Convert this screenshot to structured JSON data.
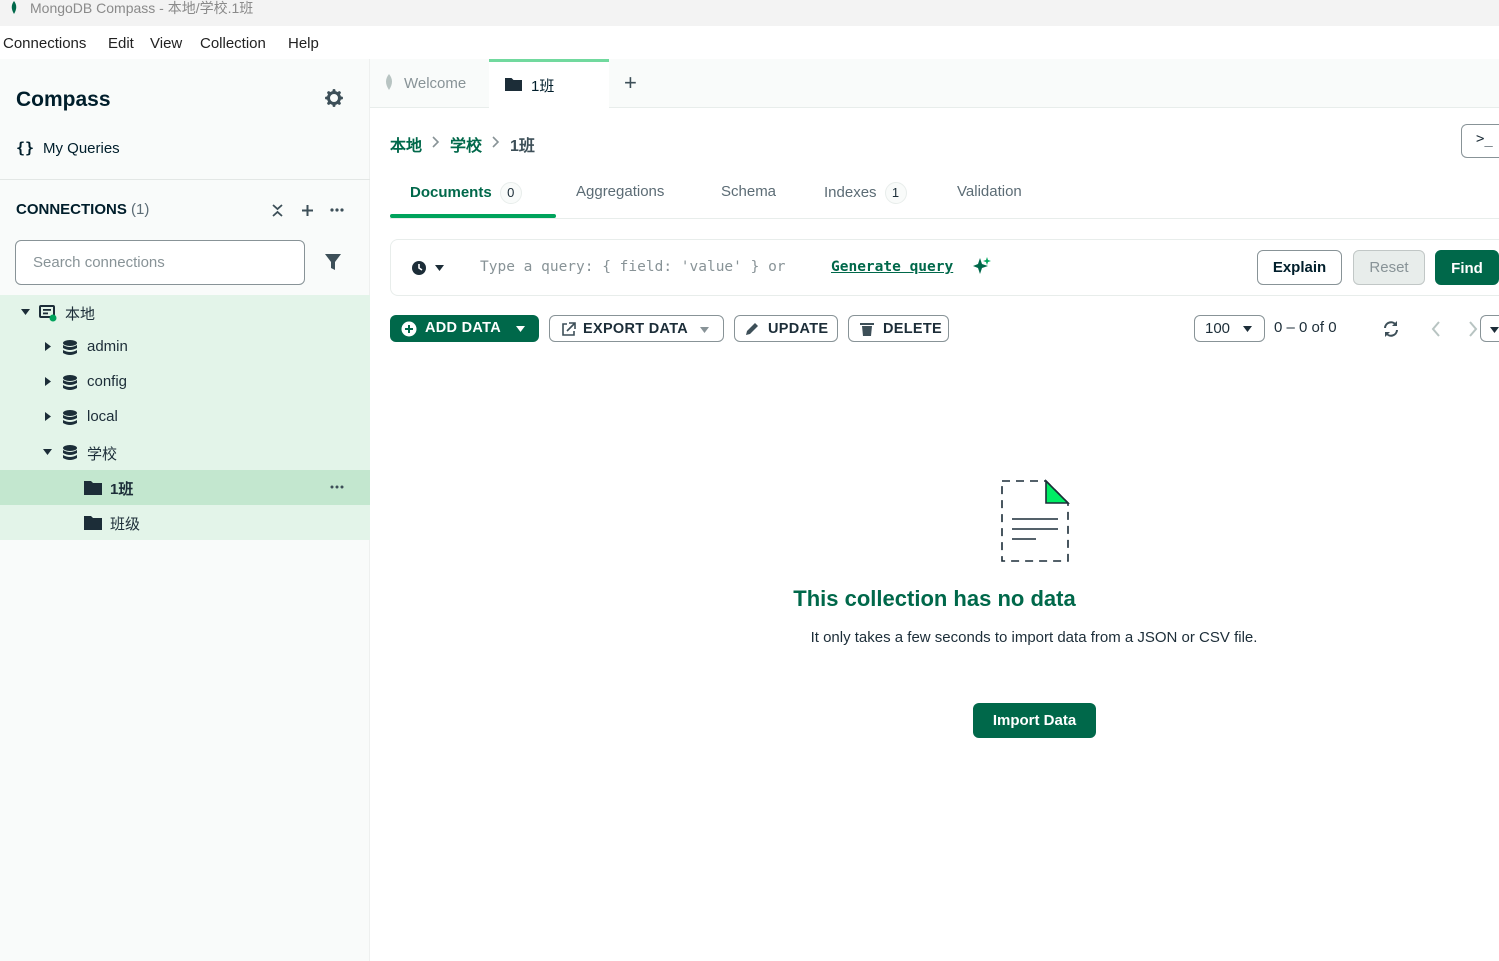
{
  "window": {
    "title": "MongoDB Compass - 本地/学校.1班"
  },
  "menu": [
    "Connections",
    "Edit",
    "View",
    "Collection",
    "Help"
  ],
  "sidebar": {
    "title": "Compass",
    "my_queries": "My Queries",
    "connections_label": "CONNECTIONS",
    "connections_count": "(1)",
    "search_placeholder": "Search connections",
    "tree": {
      "connection": "本地",
      "databases": [
        "admin",
        "config",
        "local",
        "学校"
      ],
      "collections": [
        "1班",
        "班级"
      ]
    }
  },
  "tabs": {
    "welcome": "Welcome",
    "active": "1班"
  },
  "breadcrumb": {
    "connection": "本地",
    "database": "学校",
    "collection": "1班"
  },
  "subtabs": {
    "documents": "Documents",
    "documents_count": "0",
    "aggregations": "Aggregations",
    "schema": "Schema",
    "indexes": "Indexes",
    "indexes_count": "1",
    "validation": "Validation"
  },
  "query": {
    "placeholder_text": "Type a query: { field: 'value' } or",
    "generate_link": "Generate query",
    "explain": "Explain",
    "reset": "Reset",
    "find": "Find"
  },
  "actions": {
    "add_data": "ADD DATA",
    "export_data": "EXPORT DATA",
    "update": "UPDATE",
    "delete": "DELETE",
    "page_size": "100",
    "range": "0 – 0 of 0"
  },
  "empty_state": {
    "title": "This collection has no data",
    "description": "It only takes a few seconds to import data from a JSON or CSV file.",
    "button": "Import Data"
  },
  "colors": {
    "brand_green": "#00684a",
    "accent_green": "#00a35c",
    "selection": "#c3e7cf",
    "tree_bg": "#e3f4e9"
  }
}
